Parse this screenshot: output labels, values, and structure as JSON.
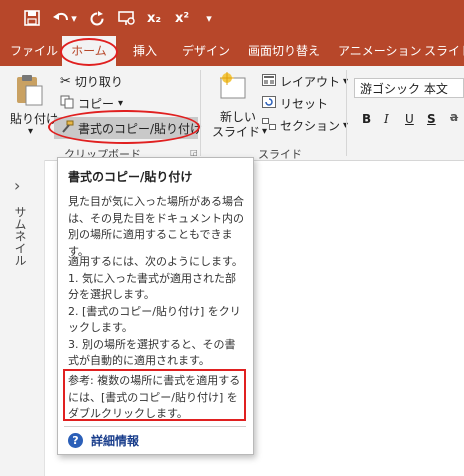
{
  "qat": {
    "save_icon": "save-icon",
    "undo_icon": "undo-icon",
    "redo_icon": "redo-icon",
    "present_icon": "present-icon",
    "subscript": "x₂",
    "superscript": "x²",
    "customize_icon": "customize-qat-icon"
  },
  "tabs": [
    "ファイル",
    "ホーム",
    "挿入",
    "デザイン",
    "画面切り替え",
    "アニメーション",
    "スライド"
  ],
  "ribbon": {
    "paste": "貼り付け",
    "cut": "切り取り",
    "copy": "コピー",
    "format_painter": "書式のコピー/貼り付け",
    "clipboard_group": "クリップボード",
    "new_slide_1": "新しい",
    "new_slide_2": "スライド",
    "layout": "レイアウト",
    "reset": "リセット",
    "section": "セクション",
    "slides_group": "スライド",
    "font_name": "游ゴシック 本文",
    "bold": "B",
    "italic": "I",
    "underline": "U",
    "strike": "S",
    "more": "a"
  },
  "pane": {
    "expand": "›",
    "thumbnails": "サムネイル"
  },
  "tooltip": {
    "title": "書式のコピー/貼り付け",
    "p1": "見た目が気に入った場所がある場合は、その見た目をドキュメント内の別の場所に適用することもできます。",
    "p2": "適用するには、次のようにします。\n1. 気に入った書式が適用された部分を選択します。\n2. [書式のコピー/貼り付け] をクリックします。\n3. 別の場所を選択すると、その書式が自動的に適用されます。",
    "note": "参考: 複数の場所に書式を適用するには、[書式のコピー/貼り付け] をダブルクリックします。",
    "more_info": "詳細情報"
  }
}
